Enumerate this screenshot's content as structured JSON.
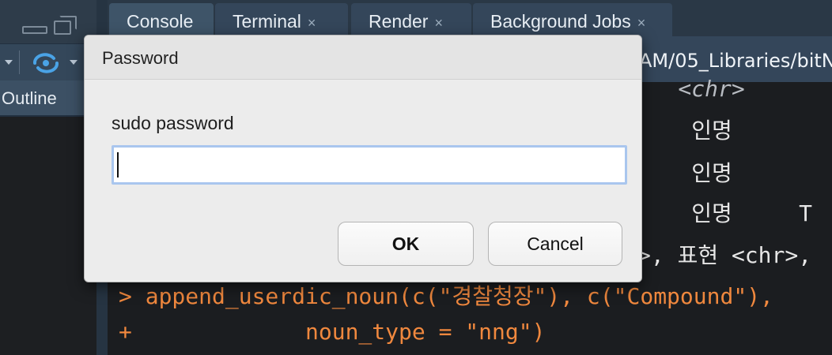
{
  "left_pane": {
    "outline_tab_label": "Outline"
  },
  "tabs": [
    {
      "label": "Console",
      "active": true,
      "closable": false
    },
    {
      "label": "Terminal",
      "active": false,
      "closable": true
    },
    {
      "label": "Render",
      "active": false,
      "closable": true
    },
    {
      "label": "Background Jobs",
      "active": false,
      "closable": true
    }
  ],
  "tab_close_glyph": "×",
  "path_bar": {
    "text": "AM/05_Libraries/bitN"
  },
  "console": {
    "lines": [
      {
        "text": ">   <chr>",
        "style": "italic"
      },
      {
        "text": "     인명     ",
        "style": "normal"
      },
      {
        "text": "     인명     ",
        "style": "normal"
      },
      {
        "text": "     인명     T",
        "style": "normal"
      },
      {
        "text": ">, 표현 <chr>,",
        "style": "normal"
      },
      {
        "text": "> append_userdic_noun(c(\"경찰청장\"), c(\"Compound\"),",
        "style": "orange"
      },
      {
        "text": "+             noun_type = \"nng\")",
        "style": "orange"
      }
    ]
  },
  "dialog": {
    "title": "Password",
    "label": "sudo password",
    "input_value": "",
    "ok_label": "OK",
    "cancel_label": "Cancel"
  },
  "colors": {
    "accent_input_border": "#a9c6ee",
    "console_orange": "#f0883e",
    "pane_header": "#34465a"
  },
  "icons": [
    "window-minimize-icon",
    "window-maximize-icon",
    "sync-icon",
    "chevron-down-icon"
  ]
}
